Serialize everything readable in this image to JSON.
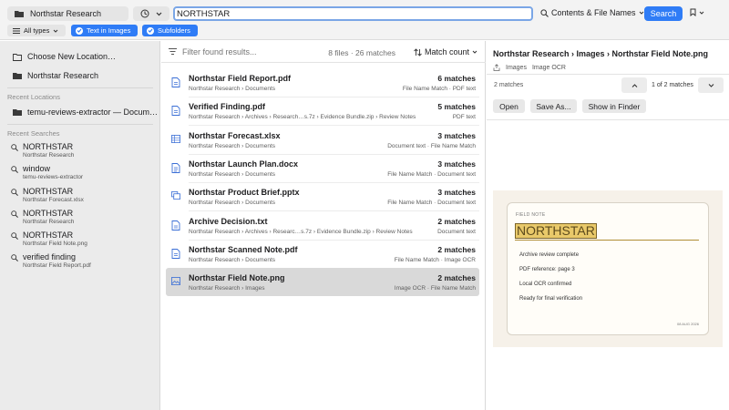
{
  "toolbar": {
    "location": "Northstar Research",
    "query": "NORTHSTAR",
    "scope": "Contents & File Names",
    "search_label": "Search",
    "types": "All types",
    "chip_images": "Text in Images",
    "chip_sub": "Subfolders"
  },
  "sidebar": {
    "choose": "Choose New Location…",
    "current": "Northstar Research",
    "recent_loc_title": "Recent Locations",
    "recent_loc": "temu-reviews-extractor — Docum…",
    "recent_search_title": "Recent Searches",
    "searches": [
      {
        "q": "NORTHSTAR",
        "loc": "Northstar Research"
      },
      {
        "q": "window",
        "loc": "temu-reviews-extractor"
      },
      {
        "q": "NORTHSTAR",
        "loc": "Northstar Forecast.xlsx"
      },
      {
        "q": "NORTHSTAR",
        "loc": "Northstar Research"
      },
      {
        "q": "NORTHSTAR",
        "loc": "Northstar Field Note.png"
      },
      {
        "q": "verified finding",
        "loc": "Northstar Field Report.pdf"
      }
    ]
  },
  "results": {
    "filter_placeholder": "Filter found results...",
    "count": "8 files · 26 matches",
    "sort": "Match count",
    "rows": [
      {
        "name": "Northstar Field Report.pdf",
        "path": "Northstar Research › Documents",
        "matches": "6 matches",
        "sources": "File Name Match · PDF text",
        "icon": "pdf-icon"
      },
      {
        "name": "Verified Finding.pdf",
        "path": "Northstar Research › Archives › Research…s.7z › Evidence Bundle.zip › Review Notes",
        "matches": "5 matches",
        "sources": "PDF text",
        "icon": "pdf-icon"
      },
      {
        "name": "Northstar Forecast.xlsx",
        "path": "Northstar Research › Documents",
        "matches": "3 matches",
        "sources": "Document text · File Name Match",
        "icon": "spreadsheet-icon"
      },
      {
        "name": "Northstar Launch Plan.docx",
        "path": "Northstar Research › Documents",
        "matches": "3 matches",
        "sources": "File Name Match · Document text",
        "icon": "document-icon"
      },
      {
        "name": "Northstar Product Brief.pptx",
        "path": "Northstar Research › Documents",
        "matches": "3 matches",
        "sources": "File Name Match · Document text",
        "icon": "presentation-icon"
      },
      {
        "name": "Archive Decision.txt",
        "path": "Northstar Research › Archives › Researc…s.7z › Evidence Bundle.zip › Review Notes",
        "matches": "2 matches",
        "sources": "Document text",
        "icon": "text-file-icon"
      },
      {
        "name": "Northstar Scanned Note.pdf",
        "path": "Northstar Research › Documents",
        "matches": "2 matches",
        "sources": "File Name Match · Image OCR",
        "icon": "pdf-icon"
      },
      {
        "name": "Northstar Field Note.png",
        "path": "Northstar Research › Images",
        "matches": "2 matches",
        "sources": "Image OCR · File Name Match",
        "icon": "image-icon"
      }
    ]
  },
  "preview": {
    "breadcrumb": "Northstar Research › Images › Northstar Field Note.png",
    "tag_folder": "Images",
    "tag_kind": "Image OCR",
    "match_count": "2 matches",
    "of": "1 of 2 matches",
    "open": "Open",
    "save_as": "Save As...",
    "show_finder": "Show in Finder",
    "note": {
      "label": "FIELD NOTE",
      "headline": "NORTHSTAR",
      "lines": [
        "Archive review complete",
        "PDF reference: page 3",
        "Local OCR confirmed",
        "Ready for final verification"
      ],
      "date": "08 AUG 2026"
    }
  },
  "colors": {
    "accent": "#2f7cf6",
    "sidebar": "#ebebeb",
    "highlight": "#e9c96a"
  }
}
